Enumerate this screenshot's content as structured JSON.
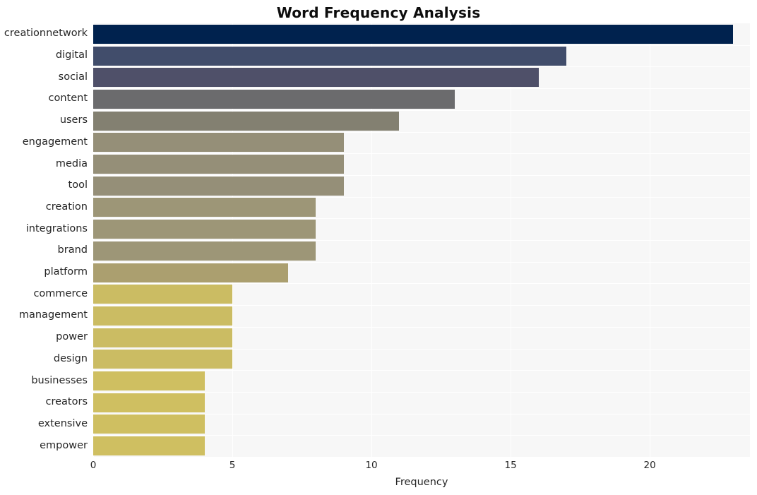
{
  "chart_data": {
    "type": "bar",
    "orientation": "horizontal",
    "title": "Word Frequency Analysis",
    "xlabel": "Frequency",
    "ylabel": "",
    "xlim": [
      0,
      23.6
    ],
    "ylim_categories": 20,
    "grid": true,
    "grid_axis": "x",
    "legend": false,
    "categories": [
      "creationnetwork",
      "digital",
      "social",
      "content",
      "users",
      "engagement",
      "media",
      "tool",
      "creation",
      "integrations",
      "brand",
      "platform",
      "commerce",
      "management",
      "power",
      "design",
      "businesses",
      "creators",
      "extensive",
      "empower"
    ],
    "values": [
      23,
      17,
      16,
      13,
      11,
      9,
      9,
      9,
      8,
      8,
      8,
      7,
      5,
      5,
      5,
      5,
      4,
      4,
      4,
      4
    ],
    "xticks": [
      0,
      5,
      10,
      15,
      20
    ],
    "xtick_labels": [
      "0",
      "5",
      "10",
      "15",
      "20"
    ],
    "bar_colors": [
      "#00224e",
      "#414d6b",
      "#4f5069",
      "#6b6b6d",
      "#838071",
      "#958f78",
      "#958f78",
      "#958f78",
      "#9d9677",
      "#9d9677",
      "#9d9677",
      "#ab9f6f",
      "#cbbc63",
      "#cbbc63",
      "#cbbc63",
      "#cbbc63",
      "#cfbf61",
      "#cfbf61",
      "#cfbf61",
      "#cfbf61"
    ],
    "colormap": "cividis",
    "plot_background": "#f7f7f7",
    "figure_background": "#ffffff",
    "text_color": "#262626",
    "title_color": "#0d0d0d"
  }
}
